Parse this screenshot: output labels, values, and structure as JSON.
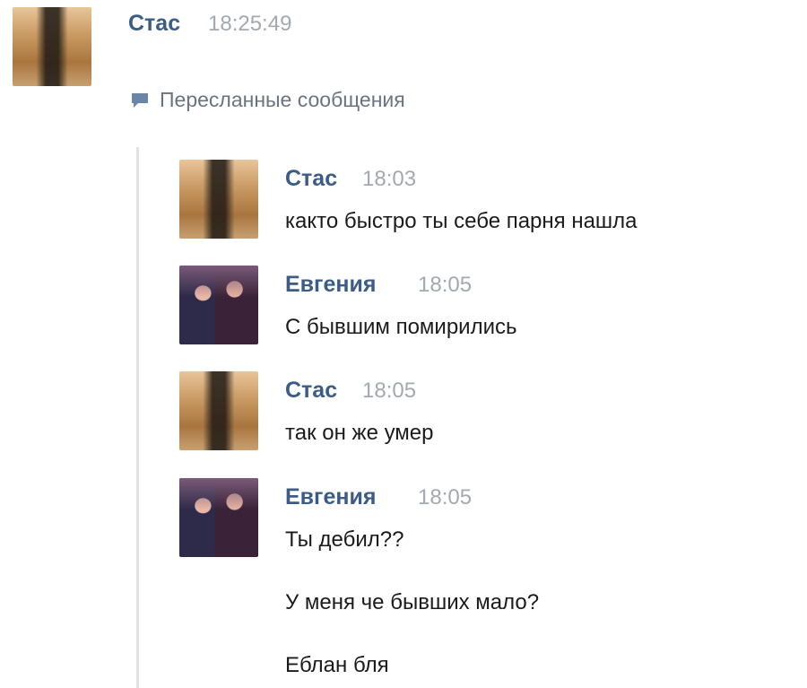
{
  "header": {
    "author": "Стас",
    "time": "18:25:49",
    "avatar_icon": "user-avatar-photo"
  },
  "forwarded": {
    "label": "Пересланные сообщения",
    "icon": "speech-bubble-icon",
    "accent_color": "#6b85a6"
  },
  "messages": [
    {
      "author": "Стас",
      "time": "18:03",
      "lines": [
        "както быстро ты себе парня нашла"
      ]
    },
    {
      "author": "Евгения",
      "time": "18:05",
      "lines": [
        "С бывшим помирились"
      ]
    },
    {
      "author": "Стас",
      "time": "18:05",
      "lines": [
        "так он же умер"
      ]
    },
    {
      "author": "Евгения",
      "time": "18:05",
      "lines": [
        "Ты дебил??",
        "У меня че бывших мало?",
        "Еблан бля"
      ]
    }
  ],
  "colors": {
    "author_name": "#3b5c86",
    "timestamp": "#a3a9b1",
    "background": "#ffffff"
  }
}
